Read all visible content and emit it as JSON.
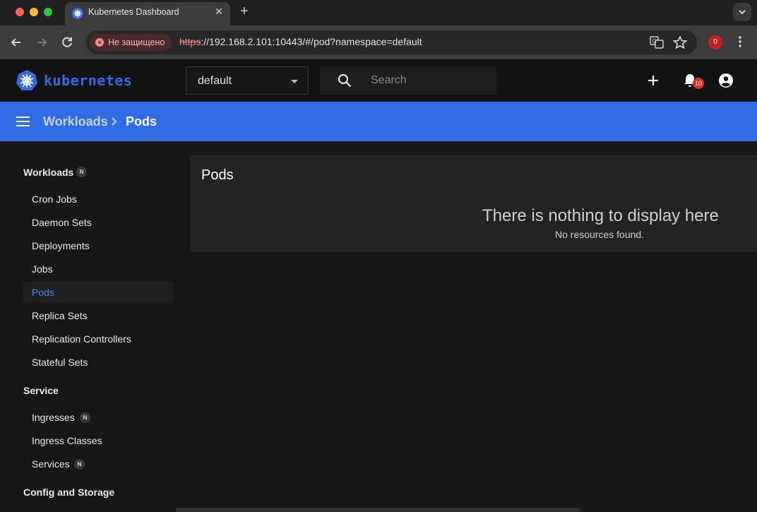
{
  "browser": {
    "tab_title": "Kubernetes Dashboard",
    "security_label": "Не защищено",
    "url_scheme": "https",
    "url_rest": "://192.168.2.101:10443/#/pod?namespace=default",
    "extension_badge": "0"
  },
  "header": {
    "logo_text": "kubernetes",
    "namespace": "default",
    "search_placeholder": "Search",
    "notification_count": "10"
  },
  "breadcrumb": {
    "parent": "Workloads",
    "current": "Pods"
  },
  "sidebar": {
    "sections": [
      {
        "title": "Workloads",
        "badge": "N"
      },
      {
        "title": "Service"
      },
      {
        "title": "Config and Storage"
      }
    ],
    "workload_items": [
      {
        "label": "Cron Jobs"
      },
      {
        "label": "Daemon Sets"
      },
      {
        "label": "Deployments"
      },
      {
        "label": "Jobs"
      },
      {
        "label": "Pods",
        "active": true
      },
      {
        "label": "Replica Sets"
      },
      {
        "label": "Replication Controllers"
      },
      {
        "label": "Stateful Sets"
      }
    ],
    "service_items": [
      {
        "label": "Ingresses",
        "badge": "N"
      },
      {
        "label": "Ingress Classes"
      },
      {
        "label": "Services",
        "badge": "N"
      }
    ]
  },
  "main": {
    "card_title": "Pods",
    "empty_title": "There is nothing to display here",
    "empty_subtitle": "No resources found."
  },
  "colors": {
    "accent": "#326ce5",
    "active_item": "#4f83f0",
    "insecure": "#f28b82"
  }
}
